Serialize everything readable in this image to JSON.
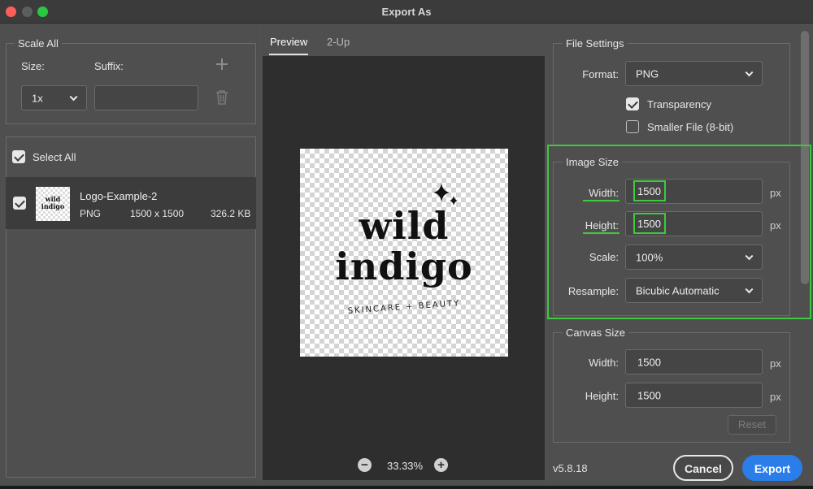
{
  "window": {
    "title": "Export As"
  },
  "scale_all": {
    "heading": "Scale All",
    "size_label": "Size:",
    "suffix_label": "Suffix:",
    "size_value": "1x",
    "suffix_value": "",
    "add_icon": "plus-icon",
    "delete_icon": "trash-icon"
  },
  "assets": {
    "select_all_label": "Select All",
    "select_all_checked": true,
    "items": [
      {
        "name": "Logo-Example-2",
        "format": "PNG",
        "dimensions": "1500 x 1500",
        "size": "326.2 KB",
        "checked": true
      }
    ]
  },
  "preview": {
    "tabs": [
      {
        "label": "Preview",
        "active": true
      },
      {
        "label": "2-Up",
        "active": false
      }
    ],
    "logo": {
      "line1": "wild",
      "line2": "indigo",
      "tagline": "SKINCARE + BEAUTY"
    },
    "zoom": "33.33%"
  },
  "file_settings": {
    "heading": "File Settings",
    "format_label": "Format:",
    "format_value": "PNG",
    "transparency_label": "Transparency",
    "transparency_checked": true,
    "smaller_file_label": "Smaller File (8-bit)",
    "smaller_file_checked": false
  },
  "image_size": {
    "heading": "Image Size",
    "width_label": "Width:",
    "width_value": "1500",
    "height_label": "Height:",
    "height_value": "1500",
    "unit": "px",
    "scale_label": "Scale:",
    "scale_value": "100%",
    "resample_label": "Resample:",
    "resample_value": "Bicubic Automatic"
  },
  "canvas_size": {
    "heading": "Canvas Size",
    "width_label": "Width:",
    "width_value": "1500",
    "height_label": "Height:",
    "height_value": "1500",
    "unit": "px",
    "reset_label": "Reset"
  },
  "footer": {
    "version": "v5.8.18",
    "cancel_label": "Cancel",
    "export_label": "Export"
  },
  "colors": {
    "highlight": "#3ec93e",
    "accent": "#2b7de9"
  }
}
